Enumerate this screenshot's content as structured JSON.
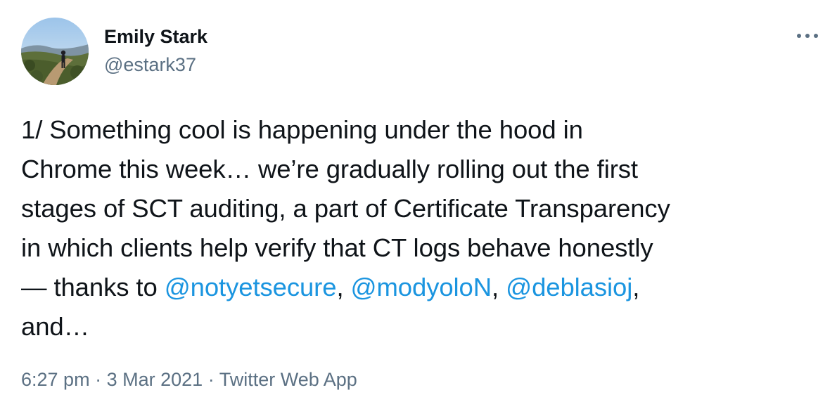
{
  "author": {
    "display_name": "Emily Stark",
    "handle": "@estark37",
    "avatar_icon": "profile-photo-hiker"
  },
  "more_icon": "more-horizontal-icon",
  "tweet": {
    "lines": [
      {
        "parts": [
          {
            "text": "1/ Something cool is happening under the hood in",
            "mention": false
          }
        ]
      },
      {
        "parts": [
          {
            "text": "Chrome this week… we’re gradually rolling out the first",
            "mention": false
          }
        ]
      },
      {
        "parts": [
          {
            "text": "stages of SCT auditing, a part of Certificate Transparency",
            "mention": false
          }
        ]
      },
      {
        "parts": [
          {
            "text": "in which clients help verify that CT logs behave honestly",
            "mention": false
          }
        ]
      },
      {
        "parts": [
          {
            "text": "— thanks to ",
            "mention": false
          },
          {
            "text": "@notyetsecure",
            "mention": true
          },
          {
            "text": ", ",
            "mention": false
          },
          {
            "text": "@modyoloN",
            "mention": true
          },
          {
            "text": ", ",
            "mention": false
          },
          {
            "text": "@deblasioj",
            "mention": true
          },
          {
            "text": ",",
            "mention": false
          }
        ]
      },
      {
        "parts": [
          {
            "text": "and…",
            "mention": false
          }
        ]
      }
    ]
  },
  "meta": {
    "time": "6:27 pm",
    "separator": "·",
    "date": "3 Mar 2021",
    "source": "Twitter Web App"
  },
  "colors": {
    "text": "#0f1419",
    "secondary": "#5b7083",
    "link": "#1b95e0"
  }
}
